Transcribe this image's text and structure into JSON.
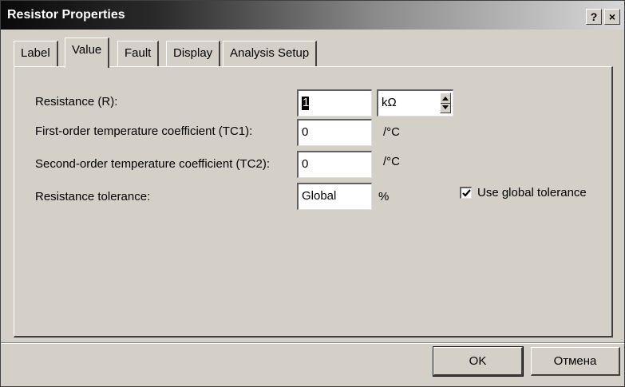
{
  "window": {
    "title": "Resistor Properties",
    "help_label": "?",
    "close_label": "×"
  },
  "tabs": [
    {
      "label": "Label"
    },
    {
      "label": "Value",
      "active": true
    },
    {
      "label": "Fault"
    },
    {
      "label": "Display"
    },
    {
      "label": "Analysis Setup"
    }
  ],
  "form": {
    "resistance": {
      "label": "Resistance (R):",
      "value": "1",
      "unit": "kΩ"
    },
    "tc1": {
      "label": "First-order temperature coefficient (TC1):",
      "value": "0",
      "unit": "/°C"
    },
    "tc2": {
      "label": "Second-order temperature coefficient (TC2):",
      "value": "0",
      "unit": "/°C"
    },
    "tolerance": {
      "label": "Resistance tolerance:",
      "value": "Global",
      "unit": "%"
    },
    "use_global": {
      "label": "Use global tolerance",
      "checked": true
    }
  },
  "buttons": {
    "ok": "OK",
    "cancel": "Отмена"
  },
  "colors": {
    "face": "#d4d0c8",
    "titlebar_start": "#0a0a0a",
    "titlebar_end": "#d8d8d8"
  }
}
